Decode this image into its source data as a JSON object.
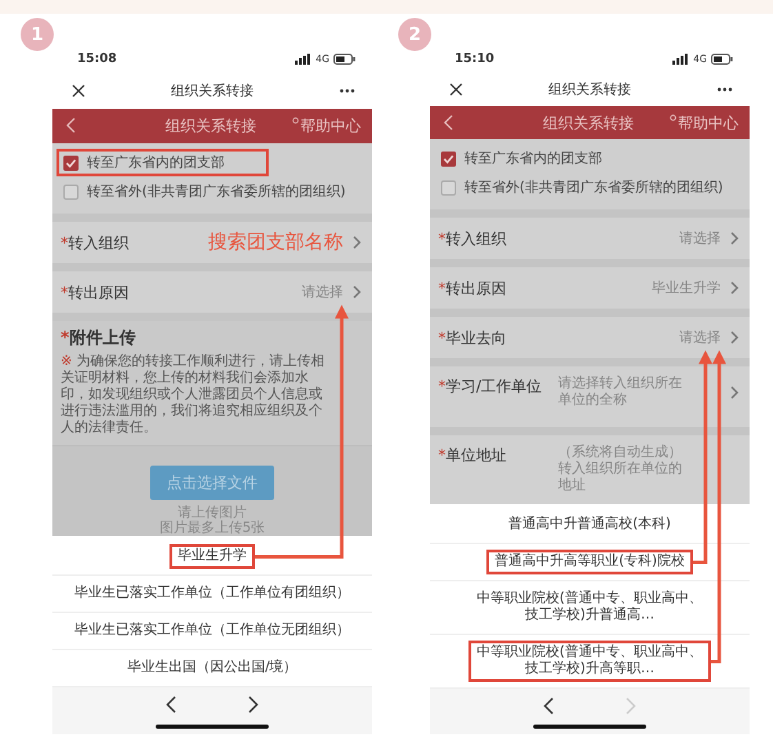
{
  "panels": [
    {
      "step": "1",
      "status_bar": {
        "time": "15:08",
        "network": "4G"
      },
      "nav": {
        "title": "组织关系转接"
      },
      "header": {
        "title": "组织关系转接",
        "help": "帮助中心"
      },
      "options": [
        {
          "label": "转至广东省内的团支部",
          "checked": true,
          "highlighted": true
        },
        {
          "label": "转至省外(非共青团广东省委所辖的团组织)",
          "checked": false,
          "highlighted": false
        }
      ],
      "fields": [
        {
          "kind": "select",
          "mark": "*",
          "label": "转入组织",
          "annotation": "搜索团支部名称"
        },
        {
          "kind": "select",
          "mark": "*",
          "label": "转出原因",
          "placeholder": "请选择",
          "arrow_target": true
        }
      ],
      "attachment": {
        "mark": "*",
        "title": "附件上传",
        "notice_mark": "※",
        "notice": "为确保您的转接工作顺利进行，请上传相关证明材料，您上传的材料我们会添加水印，如发现组织或个人泄露团员个人信息或进行违法滥用的，我们将追究相应组织及个人的法律责任。",
        "button": "点击选择文件",
        "hints": [
          "请上传图片",
          "图片最多上传5张"
        ]
      },
      "picker": {
        "options": [
          {
            "label": "毕业生升学",
            "highlighted": true
          },
          {
            "label": "毕业生已落实工作单位（工作单位有团组织）",
            "highlighted": false
          },
          {
            "label": "毕业生已落实工作单位（工作单位无团组织）",
            "highlighted": false
          },
          {
            "label": "毕业生出国（因公出国/境）",
            "highlighted": false
          }
        ],
        "prev_disabled": false,
        "next_disabled": false
      }
    },
    {
      "step": "2",
      "status_bar": {
        "time": "15:10",
        "network": "4G"
      },
      "nav": {
        "title": "组织关系转接"
      },
      "header": {
        "title": "组织关系转接",
        "help": "帮助中心"
      },
      "options": [
        {
          "label": "转至广东省内的团支部",
          "checked": true,
          "highlighted": false
        },
        {
          "label": "转至省外(非共青团广东省委所辖的团组织)",
          "checked": false,
          "highlighted": false
        }
      ],
      "fields": [
        {
          "kind": "select",
          "mark": "*",
          "label": "转入组织",
          "placeholder": "请选择"
        },
        {
          "kind": "select",
          "mark": "*",
          "label": "转出原因",
          "value": "毕业生升学"
        },
        {
          "kind": "select",
          "mark": "*",
          "label": "毕业去向",
          "placeholder": "请选择",
          "arrow_target": true
        },
        {
          "kind": "select",
          "mark": "*",
          "label": "学习/工作单位",
          "placeholder": "请选择转入组织所在单位的全称"
        },
        {
          "kind": "input",
          "mark": "*",
          "label": "单位地址",
          "placeholder": "（系统将自动生成）转入组织所在单位的地址"
        }
      ],
      "picker": {
        "options": [
          {
            "label": "普通高中升普通高校(本科)",
            "highlighted": false
          },
          {
            "label": "普通高中升高等职业(专科)院校",
            "highlighted": true
          },
          {
            "label": "中等职业院校(普通中专、职业高中、技工学校)升普通高…",
            "highlighted": false
          },
          {
            "label": "中等职业院校(普通中专、职业高中、技工学校)升高等职…",
            "highlighted": true
          }
        ],
        "prev_disabled": false,
        "next_disabled": true
      }
    }
  ]
}
